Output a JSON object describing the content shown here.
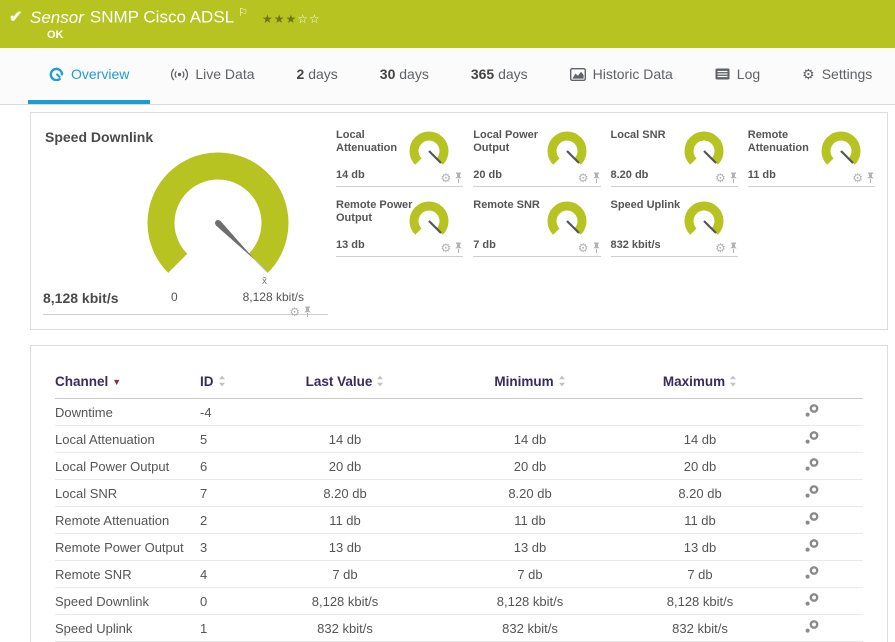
{
  "header": {
    "check_icon": "✔",
    "kind": "Sensor",
    "title": "SNMP Cisco ADSL",
    "flag_icon": "⚐",
    "stars_filled": "★★★",
    "stars_empty": "☆☆",
    "status": "OK"
  },
  "tabs": [
    {
      "label": "Overview"
    },
    {
      "label": "Live Data"
    },
    {
      "strong": "2",
      "rest": " days"
    },
    {
      "strong": "30",
      "rest": " days"
    },
    {
      "strong": "365",
      "rest": " days"
    },
    {
      "label": "Historic Data"
    },
    {
      "label": "Log"
    },
    {
      "label": "Settings"
    }
  ],
  "icons": {
    "gear": "⚙"
  },
  "gauges": {
    "main": {
      "title": "Speed Downlink",
      "value": "8,128 kbit/s",
      "scale_min": "0",
      "scale_max": "8,128 kbit/s",
      "avg_marker": "x̄"
    },
    "small": [
      {
        "label": "Local Attenuation",
        "value": "14 db"
      },
      {
        "label": "Local Power Output",
        "value": "20 db"
      },
      {
        "label": "Local SNR",
        "value": "8.20 db"
      },
      {
        "label": "Remote Attenuation",
        "value": "11 db"
      },
      {
        "label": "Remote Power Output",
        "value": "13 db"
      },
      {
        "label": "Remote SNR",
        "value": "7 db"
      },
      {
        "label": "Speed Uplink",
        "value": "832 kbit/s"
      }
    ]
  },
  "table": {
    "columns": {
      "channel": "Channel",
      "id": "ID",
      "last": "Last Value",
      "min": "Minimum",
      "max": "Maximum"
    },
    "rows": [
      {
        "channel": "Downtime",
        "id": "-4",
        "last": "",
        "min": "",
        "max": ""
      },
      {
        "channel": "Local Attenuation",
        "id": "5",
        "last": "14 db",
        "min": "14 db",
        "max": "14 db"
      },
      {
        "channel": "Local Power Output",
        "id": "6",
        "last": "20 db",
        "min": "20 db",
        "max": "20 db"
      },
      {
        "channel": "Local SNR",
        "id": "7",
        "last": "8.20 db",
        "min": "8.20 db",
        "max": "8.20 db"
      },
      {
        "channel": "Remote Attenuation",
        "id": "2",
        "last": "11 db",
        "min": "11 db",
        "max": "11 db"
      },
      {
        "channel": "Remote Power Output",
        "id": "3",
        "last": "13 db",
        "min": "13 db",
        "max": "13 db"
      },
      {
        "channel": "Remote SNR",
        "id": "4",
        "last": "7 db",
        "min": "7 db",
        "max": "7 db"
      },
      {
        "channel": "Speed Downlink",
        "id": "0",
        "last": "8,128 kbit/s",
        "min": "8,128 kbit/s",
        "max": "8,128 kbit/s"
      },
      {
        "channel": "Speed Uplink",
        "id": "1",
        "last": "832 kbit/s",
        "min": "832 kbit/s",
        "max": "832 kbit/s"
      }
    ]
  },
  "colors": {
    "brand_green": "#b6c321",
    "accent_blue": "#1e9cd8",
    "table_header_purple": "#3a2b5e",
    "sort_arrow_red": "#8b3232",
    "gauge_green": "#b6c321"
  }
}
